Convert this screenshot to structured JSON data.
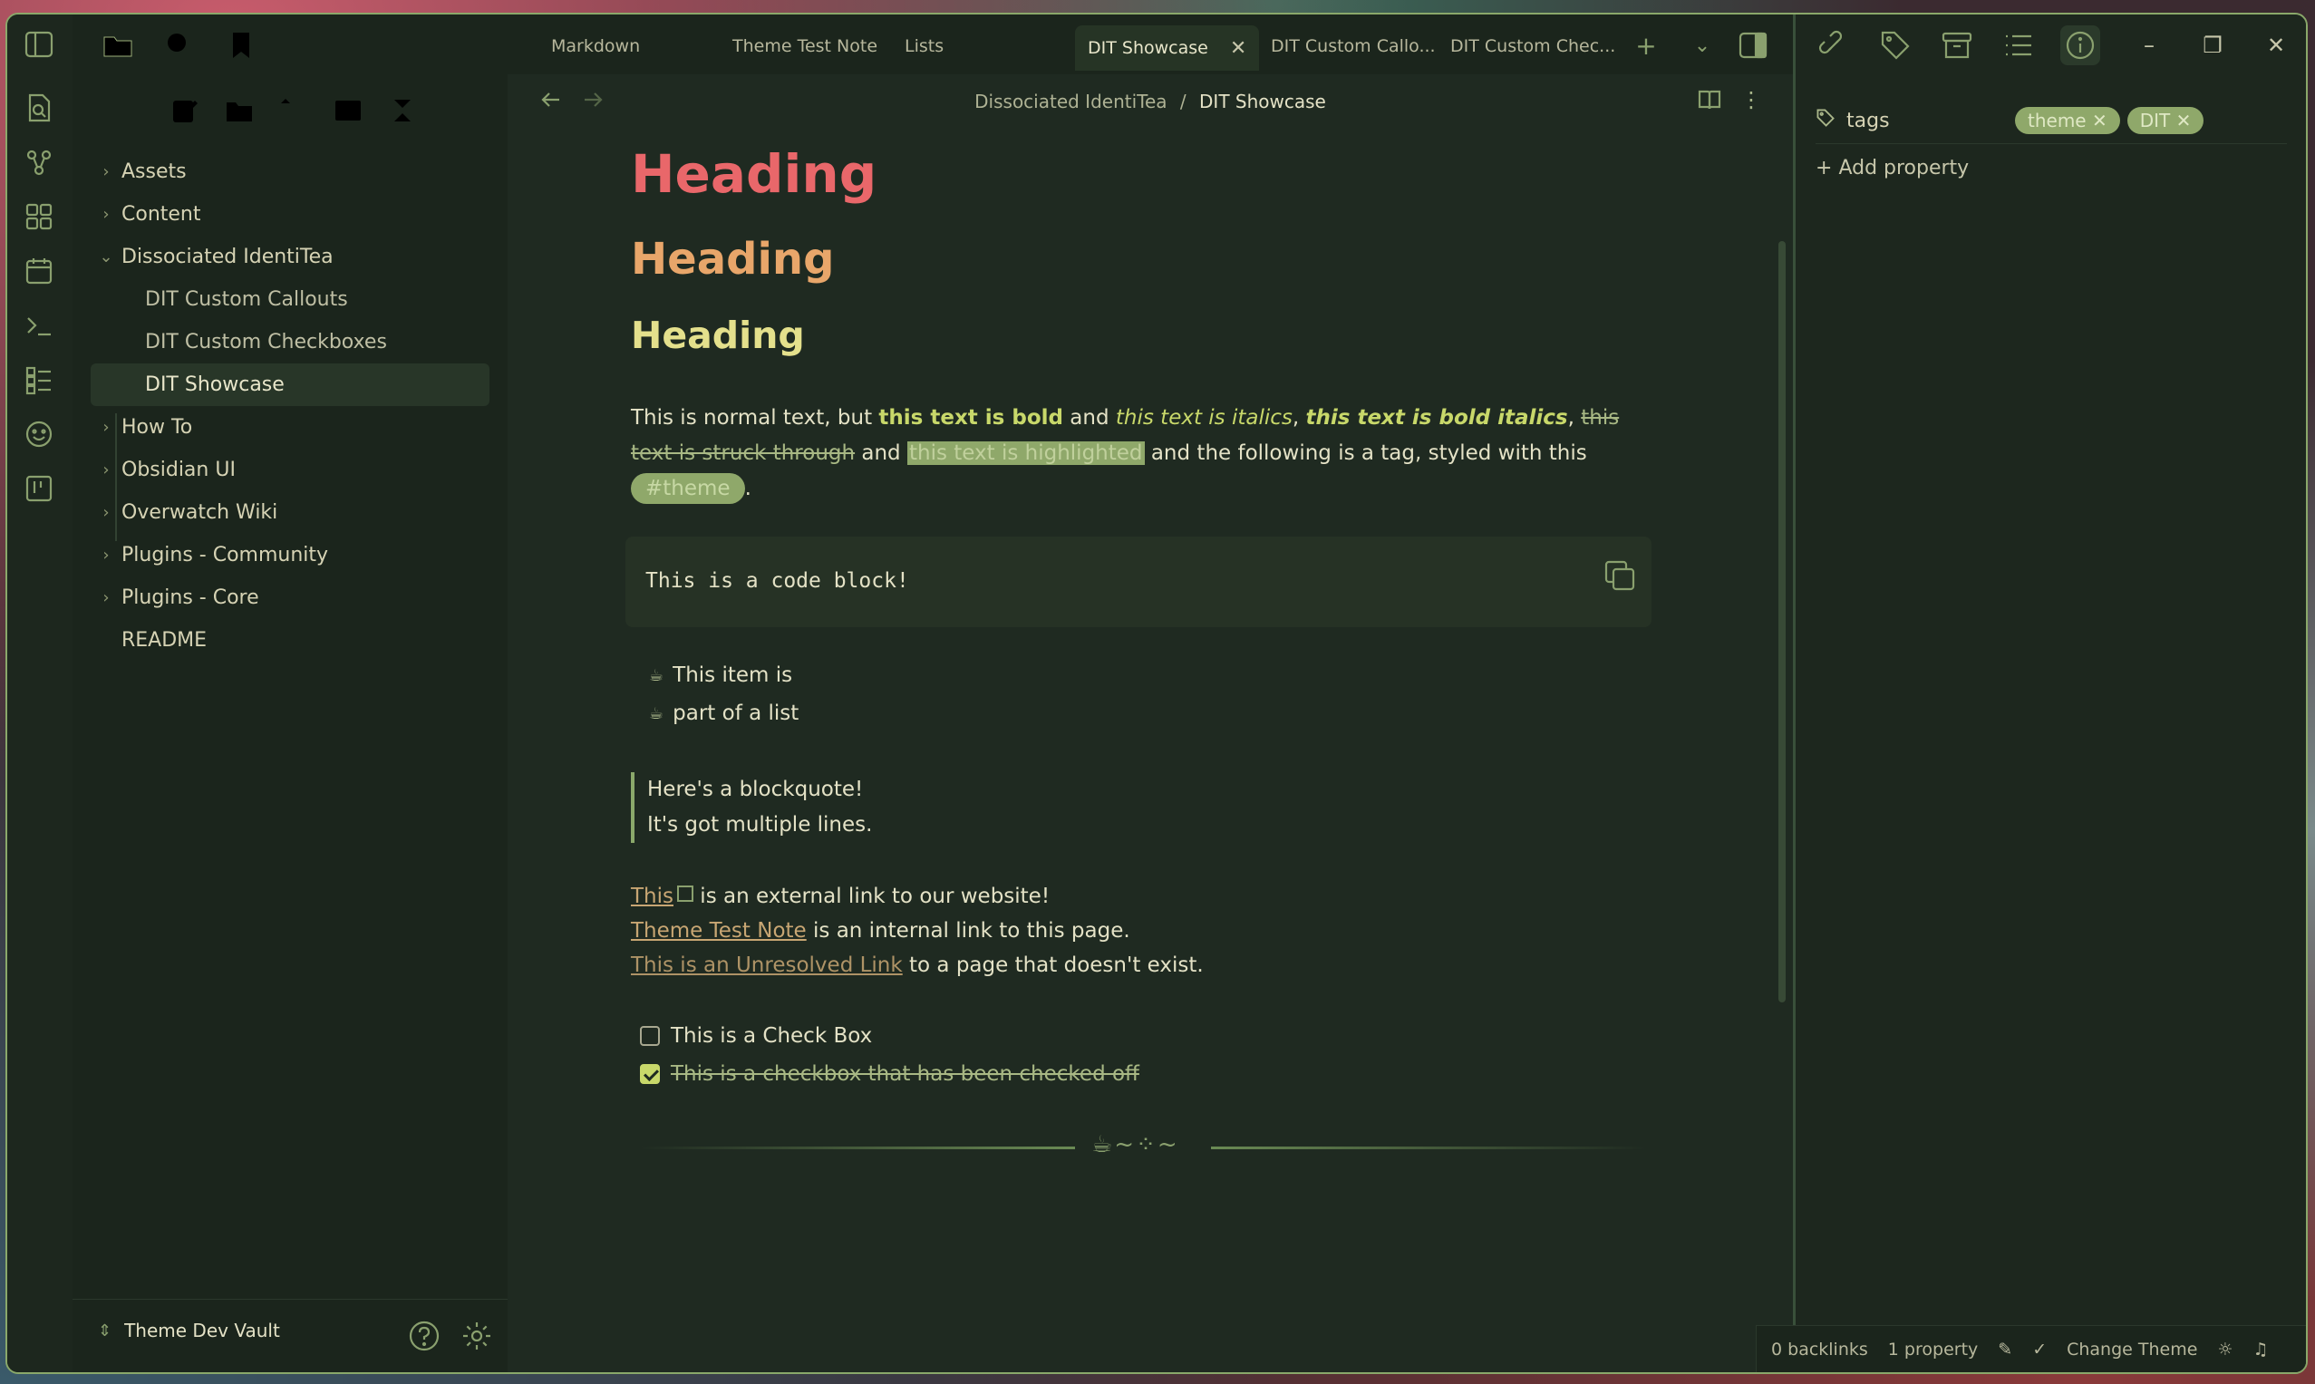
{
  "tabs": {
    "items": [
      "Markdown",
      "Theme Test Note",
      "Lists",
      "DIT Showcase",
      "DIT Custom Callo...",
      "DIT Custom Chec..."
    ],
    "active_index": 3
  },
  "sidebar": {
    "tree": {
      "assets": "Assets",
      "content": "Content",
      "dissociated": "Dissociated IdentiTea",
      "dit_callouts": "DIT Custom Callouts",
      "dit_checkboxes": "DIT Custom Checkboxes",
      "dit_showcase": "DIT Showcase",
      "how_to": "How To",
      "obsidian_ui": "Obsidian UI",
      "overwatch": "Overwatch Wiki",
      "plugins_community": "Plugins - Community",
      "plugins_core": "Plugins - Core",
      "readme": "README"
    },
    "vault_name": "Theme Dev Vault"
  },
  "breadcrumb": {
    "parent": "Dissociated IdentiTea",
    "sep": "/",
    "current": "DIT Showcase"
  },
  "note": {
    "h1": "Heading",
    "h2": "Heading",
    "h3": "Heading",
    "p_normal": "This is normal text, but ",
    "p_bold": "this text is bold",
    "p_and1": " and ",
    "p_italic": "this text is italics",
    "p_comma1": ", ",
    "p_bolditalic": "this text is bold italics",
    "p_comma2": ", ",
    "p_strike": "this text is struck through",
    "p_and2": " and ",
    "p_highlight": "this text is highlighted",
    "p_after": " and the following is a tag, styled with this ",
    "p_tag": "#theme",
    "p_period": ".",
    "code": "This is a code block!",
    "list": [
      "This item is",
      "part of a list"
    ],
    "blockquote": [
      "Here's a blockquote!",
      "It's got multiple lines."
    ],
    "link_ext": "This",
    "link_ext_rest": " is an external link to our website!",
    "link_int": "Theme Test Note",
    "link_int_rest": " is an internal link to this page.",
    "link_unres": "This is an Unresolved Link",
    "link_unres_rest": " to a page that doesn't exist.",
    "check1": "This is a Check Box",
    "check2": "This is a checkbox that has been checked off",
    "check2_done": true
  },
  "properties": {
    "tags_label": "tags",
    "tags": [
      "theme",
      "DIT"
    ],
    "add_property": "Add property"
  },
  "status": {
    "backlinks": "0 backlinks",
    "properties": "1 property",
    "change_theme": "Change Theme"
  },
  "colors": {
    "accent": "#8aa86a",
    "h1": "#e9676a",
    "h2": "#e8a66a",
    "h3": "#e4e08c",
    "emphasis": "#c8d86a",
    "link": "#c8a673"
  },
  "icons": {
    "ribbon": [
      "sidebar-toggle-icon",
      "file-search-icon",
      "graph-icon",
      "canvas-icon",
      "calendar-icon",
      "terminal-icon",
      "list-icon",
      "smiley-icon",
      "kanban-icon"
    ],
    "sidebar_top": [
      "folder-icon",
      "search-icon",
      "bookmark-icon"
    ],
    "sidebar_actions": [
      "new-note-icon",
      "new-folder-icon",
      "sort-icon",
      "collapse-view-icon",
      "collapse-all-icon"
    ],
    "right_top": [
      "link-icon",
      "tag-icon",
      "archive-icon",
      "outline-icon",
      "info-icon"
    ]
  }
}
